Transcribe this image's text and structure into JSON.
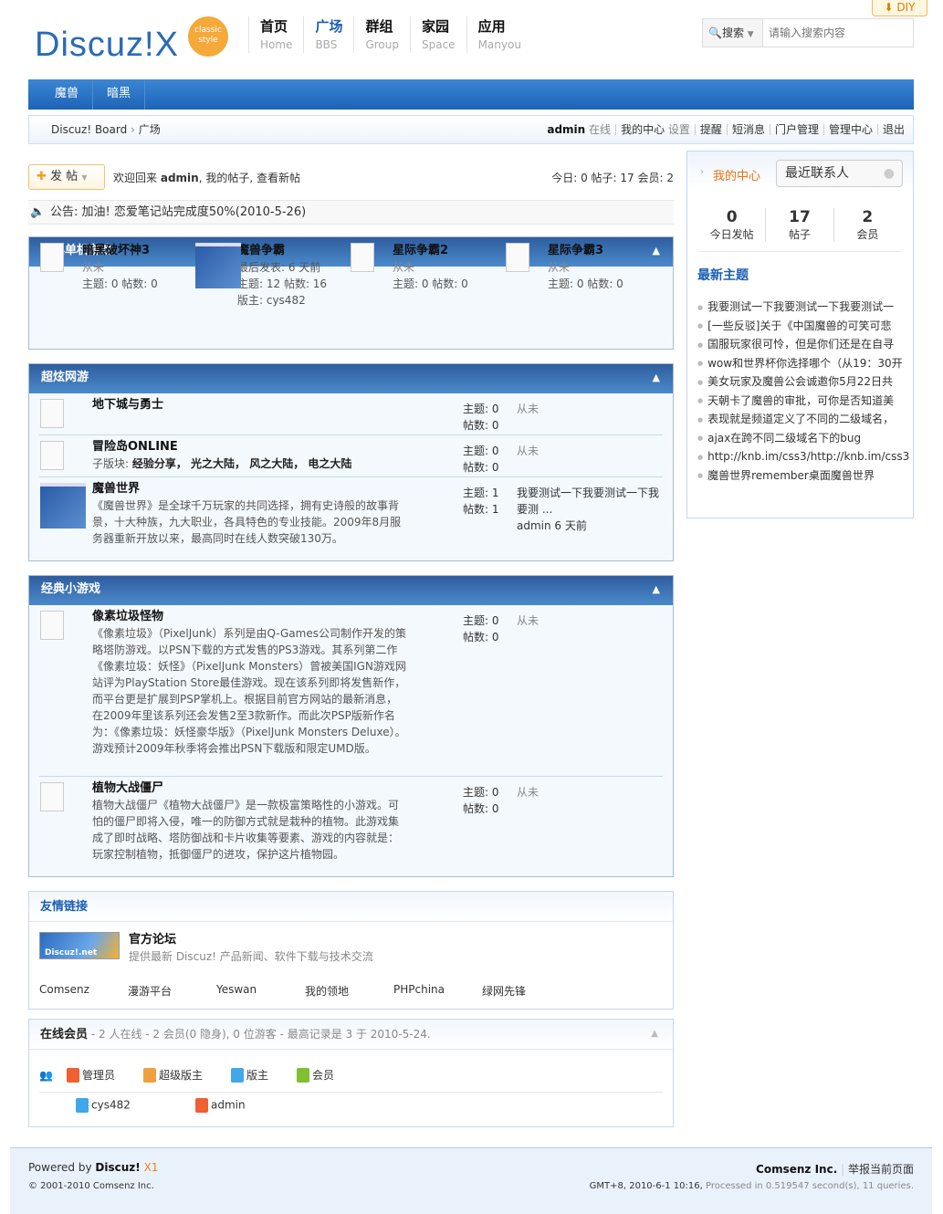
{
  "header": {
    "logo": "Discuz!X",
    "logo_badge": "classic style",
    "diy": "DIY",
    "nav": [
      {
        "zh": "首页",
        "en": "Home"
      },
      {
        "zh": "广场",
        "en": "BBS"
      },
      {
        "zh": "群组",
        "en": "Group"
      },
      {
        "zh": "家园",
        "en": "Space"
      },
      {
        "zh": "应用",
        "en": "Manyou"
      }
    ],
    "search_type": "搜索",
    "search_placeholder": "请输入搜索内容"
  },
  "subnav": [
    "魔兽",
    "暗黑"
  ],
  "breadcrumb": {
    "home": "Discuz! Board",
    "sep": "›",
    "current": "广场"
  },
  "user": {
    "name": "admin",
    "status": "在线",
    "links": [
      "我的中心",
      "设置",
      "提醒",
      "短消息",
      "门户管理",
      "管理中心",
      "退出"
    ]
  },
  "post_button": "发 帖",
  "welcome": {
    "prefix": "欢迎回来",
    "user": "admin",
    "links": "我的帖子, 查看新帖"
  },
  "stats_line": "今日: 0 帖子: 17 会员: 2",
  "notice": "公告: 加油! 恋爱笔记站完成度50%(2010-5-26)",
  "sections": [
    {
      "title": "经典单机游戏",
      "forums": [
        {
          "name": "暗黑破坏神3",
          "l1": "从未",
          "l2": "主题: 0 帖数: 0"
        },
        {
          "name": "魔兽争霸",
          "l1": "最后发表: 6 天前",
          "l2": "主题: 12 帖数: 16",
          "l3": "版主: cys482"
        },
        {
          "name": "星际争霸2",
          "l1": "从未",
          "l2": "主题: 0 帖数: 0"
        },
        {
          "name": "星际争霸3",
          "l1": "从未",
          "l2": "主题: 0 帖数: 0"
        }
      ]
    },
    {
      "title": "超炫网游",
      "forums": [
        {
          "name": "地下城与勇士",
          "topics": "主题: 0",
          "posts": "帖数: 0",
          "last": "从未"
        },
        {
          "name": "冒险岛ONLINE",
          "sub_label": "子版块:",
          "subs": "经验分享， 光之大陆， 风之大陆， 电之大陆",
          "topics": "主题: 0",
          "posts": "帖数: 0",
          "last": "从未"
        },
        {
          "name": "魔兽世界",
          "desc": "《魔兽世界》是全球千万玩家的共同选择，拥有史诗般的故事背景，十大种族，九大职业，各具特色的专业技能。2009年8月服务器重新开放以来，最高同时在线人数突破130万。",
          "topics": "主题: 1",
          "posts": "帖数: 1",
          "last": "我要测试一下我要测试一下我要测 ...",
          "last_by": "admin 6 天前"
        }
      ]
    },
    {
      "title": "经典小游戏",
      "forums": [
        {
          "name": "像素垃圾怪物",
          "desc": "《像素垃圾》（PixelJunk）系列是由Q-Games公司制作开发的策略塔防游戏。以PSN下载的方式发售的PS3游戏。其系列第二作《像素垃圾：妖怪》（PixelJunk Monsters）曾被美国IGN游戏网站评为PlayStation Store最佳游戏。现在该系列即将发售新作，而平台更是扩展到PSP掌机上。根据目前官方网站的最新消息，在2009年里该系列还会发售2至3款新作。而此次PSP版新作名为：《像素垃圾：妖怪豪华版》（PixelJunk Monsters Deluxe）。游戏预计2009年秋季将会推出PSN下载版和限定UMD版。",
          "topics": "主题: 0",
          "posts": "帖数: 0",
          "last": "从未"
        },
        {
          "name": "植物大战僵尸",
          "desc": "植物大战僵尸《植物大战僵尸》是一款极富策略性的小游戏。可怕的僵尸即将入侵，唯一的防御方式就是栽种的植物。此游戏集成了即时战略、塔防御战和卡片收集等要素、游戏的内容就是：玩家控制植物，抵御僵尸的进攻，保护这片植物园。",
          "topics": "主题: 0",
          "posts": "帖数: 0",
          "last": "从未"
        }
      ]
    }
  ],
  "sidebar": {
    "my_center": "我的中心",
    "recent_contacts": "最近联系人",
    "stats": [
      {
        "value": "0",
        "label": "今日发帖"
      },
      {
        "value": "17",
        "label": "帖子"
      },
      {
        "value": "2",
        "label": "会员"
      }
    ],
    "latest_title": "最新主题",
    "latest": [
      "我要测试一下我要测试一下我要测试一",
      "[一些反驳]关于《中国魔兽的可笑可悲",
      "国服玩家很可怜，但是你们还是在自寻",
      "wow和世界杯你选择哪个（从19：30开",
      "美女玩家及魔兽公会诚邀你5月22日共",
      "天朝卡了魔兽的审批，可你是否知道美",
      "表现就是频道定义了不同的二级域名，",
      "ajax在跨不同二级域名下的bug",
      "http://knb.im/css3/http://knb.im/css3",
      "魔兽世界remember桌面魔兽世界"
    ]
  },
  "links": {
    "title": "友情链接",
    "logo_text": "Discuz!.net",
    "featured_name": "官方论坛",
    "featured_desc": "提供最新 Discuz! 产品新闻、软件下载与技术交流",
    "text_links": [
      "Comsenz",
      "漫游平台",
      "Yeswan",
      "我的领地",
      "PHPchina",
      "绿网先锋"
    ]
  },
  "online": {
    "title": "在线会员",
    "summary": "- 2 人在线 - 2 会员(0 隐身), 0 位游客 - 最高记录是 3 于 2010-5-24.",
    "legend": [
      "管理员",
      "超级版主",
      "版主",
      "会员"
    ],
    "members": [
      "cys482",
      "admin"
    ]
  },
  "footer": {
    "powered": "Powered by",
    "brand": "Discuz!",
    "version": "X1",
    "copyright": "© 2001-2010 Comsenz Inc.",
    "company": "Comsenz Inc.",
    "report": "举报当前页面",
    "time": "GMT+8, 2010-6-1 10:16,",
    "processed": "Processed in 0.519547 second(s), 11 queries."
  },
  "colors": {
    "brand_blue": "#1e63b6",
    "accent_orange": "#f07010"
  }
}
